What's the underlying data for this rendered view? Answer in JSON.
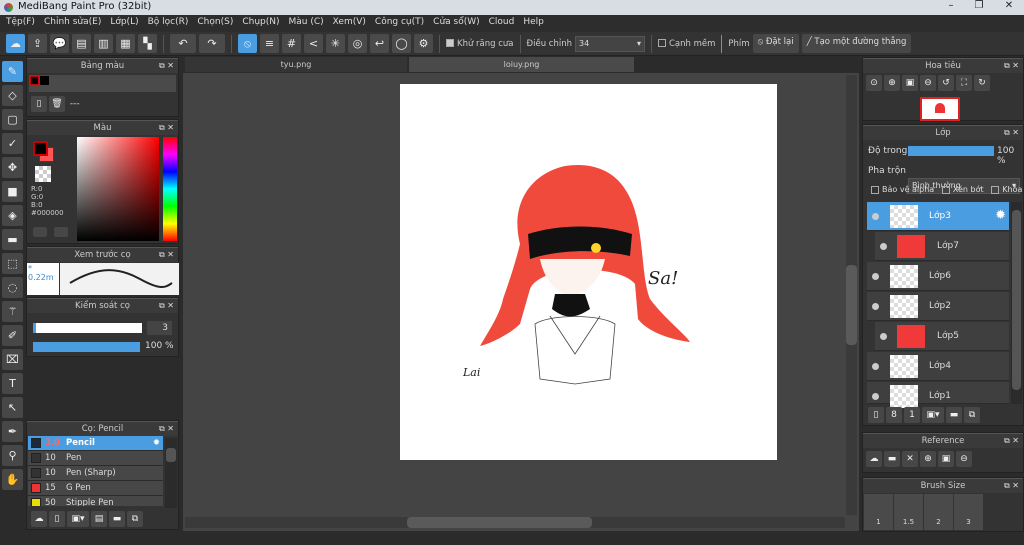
{
  "window": {
    "title": "MediBang Paint Pro (32bit)",
    "controls": [
      "–",
      "❐",
      "✕"
    ]
  },
  "menu": [
    "Tệp(F)",
    "Chỉnh sửa(E)",
    "Lớp(L)",
    "Bộ lọc(R)",
    "Chọn(S)",
    "Chụp(N)",
    "Màu (C)",
    "Xem(V)",
    "Công cụ(T)",
    "Cửa sổ(W)",
    "Cloud",
    "Help"
  ],
  "toolbar": {
    "antialias_label": "Khử răng cưa",
    "adjust_label": "Điều chỉnh",
    "adjust_value": "34",
    "soft_edge_label": "Cạnh mềm",
    "key_label": "Phím",
    "reset_label": "Đặt lại",
    "straight_line_label": "Tạo một đường thẳng"
  },
  "panels": {
    "palette": {
      "title": "Bảng màu",
      "dots": "---"
    },
    "color": {
      "title": "Màu",
      "r": "R:0",
      "g": "G:0",
      "b": "B:0",
      "hex": "#000000",
      "primary": "#000000",
      "secondary": "#ff5555"
    },
    "brush_preview": {
      "title": "Xem trước cọ",
      "size": "* 0.22m"
    },
    "brush_control": {
      "title": "Kiểm soát cọ",
      "size": "3",
      "opacity": "100 %",
      "size_fraction": 0.03,
      "opacity_fraction": 1.0
    },
    "brushes": {
      "title": "Cọ: Pencil",
      "items": [
        {
          "size": "3.0",
          "name": "Pencil",
          "color": "#1a2a3a",
          "active": true
        },
        {
          "size": "10",
          "name": "Pen",
          "color": "#333333"
        },
        {
          "size": "10",
          "name": "Pen (Sharp)",
          "color": "#333333"
        },
        {
          "size": "15",
          "name": "G Pen",
          "color": "#ee3333"
        },
        {
          "size": "50",
          "name": "Stipple Pen",
          "color": "#e8e000"
        }
      ]
    }
  },
  "tabs": [
    {
      "label": "tyu.png",
      "active": false
    },
    {
      "label": "loiuy.png",
      "active": true
    }
  ],
  "canvas": {
    "text1": "Sa!",
    "text2": "Lai"
  },
  "navigator": {
    "title": "Hoa tiêu"
  },
  "layers": {
    "title": "Lớp",
    "opacity_label": "Độ trong",
    "opacity_value": "100 %",
    "opacity_fraction": 1.0,
    "blend_label": "Pha trộn",
    "blend_value": "Bình thường",
    "protect_alpha": "Bảo vệ alpha",
    "clip": "Xén bớt",
    "lock": "Khóa",
    "items": [
      {
        "name": "Lớp3",
        "active": true
      },
      {
        "name": "Lớp7",
        "clip": true
      },
      {
        "name": "Lớp6"
      },
      {
        "name": "Lớp2"
      },
      {
        "name": "Lớp5",
        "clip": true
      },
      {
        "name": "Lớp4"
      },
      {
        "name": "Lớp1"
      }
    ]
  },
  "reference": {
    "title": "Reference"
  },
  "brush_size": {
    "title": "Brush Size",
    "sizes": [
      "1",
      "1.5",
      "2",
      "3"
    ]
  }
}
